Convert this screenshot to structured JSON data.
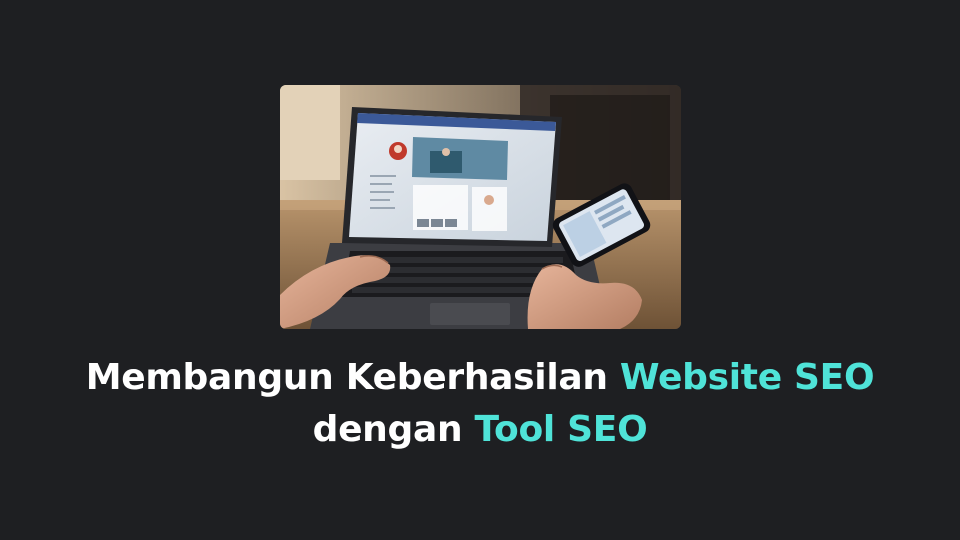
{
  "headline": {
    "line1_prefix": "Membangun Keberhasilan ",
    "line1_accent": "Website SEO",
    "line2_prefix": "dengan ",
    "line2_accent": "Tool SEO"
  },
  "colors": {
    "background": "#1e1f22",
    "text": "#ffffff",
    "accent": "#4fe3d8"
  }
}
